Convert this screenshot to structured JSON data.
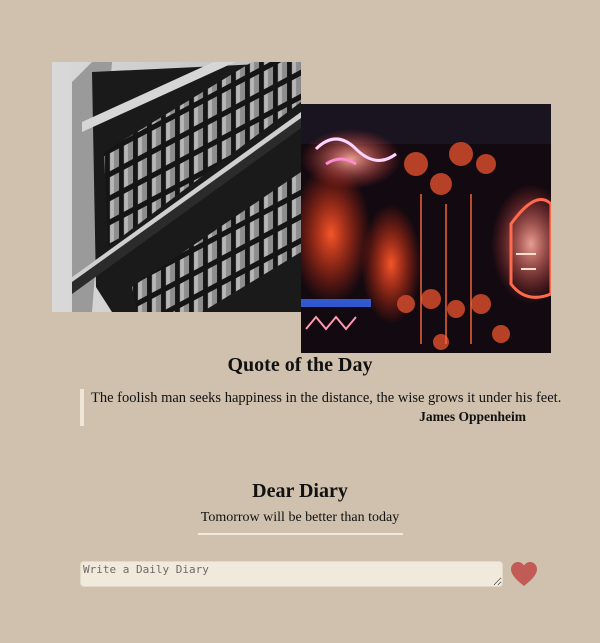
{
  "quote_section": {
    "heading": "Quote of the Day",
    "text": "The foolish man seeks happiness in the distance, the wise grows it under his feet.",
    "author": "James Oppenheim"
  },
  "diary_section": {
    "heading": "Dear Diary",
    "subtitle": "Tomorrow will be better than today",
    "input_placeholder": "Write a Daily Diary",
    "submit_icon": "heart-icon"
  },
  "colors": {
    "background": "#d0c1ae",
    "accent": "#f1e9dc",
    "heart": "#c25a55"
  }
}
